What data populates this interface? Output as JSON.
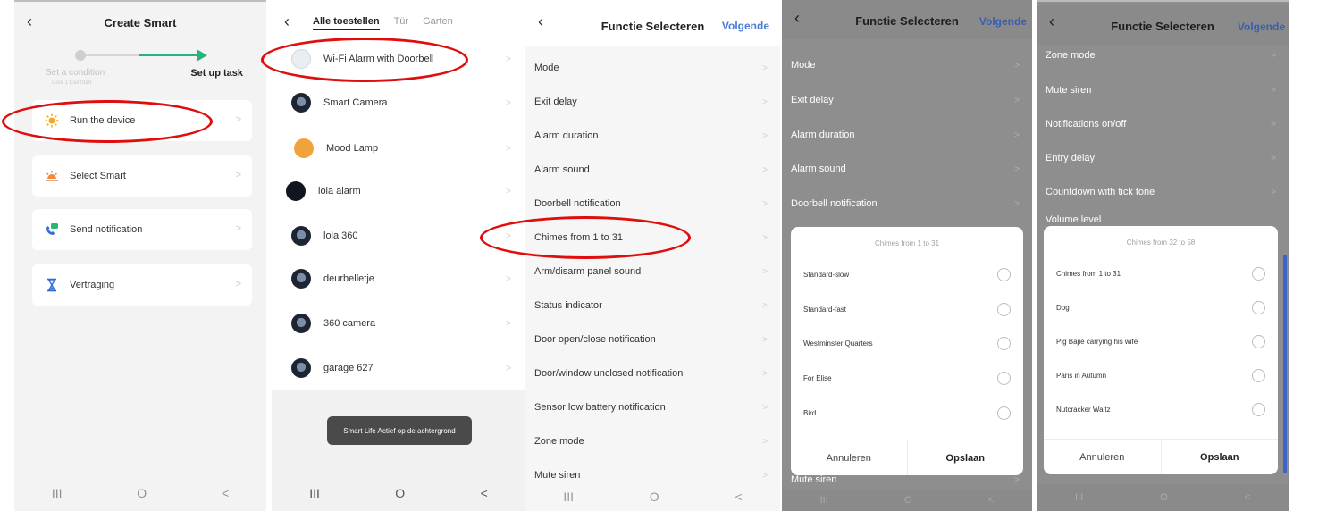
{
  "panel1": {
    "title": "Create Smart",
    "step_left": "Set a condition",
    "step_left_sub": "Door 1 Call Start",
    "step_right": "Set up task",
    "cards": [
      {
        "label": "Run the device",
        "icon": "sun-icon"
      },
      {
        "label": "Select Smart",
        "icon": "sunrise-icon"
      },
      {
        "label": "Send notification",
        "icon": "phone-message-icon"
      },
      {
        "label": "Vertraging",
        "icon": "hourglass-icon"
      }
    ],
    "nav": [
      "III",
      "O",
      "<"
    ]
  },
  "panel2": {
    "tabs": [
      "Alle toestellen",
      "Tür",
      "Garten"
    ],
    "devices": [
      {
        "label": "Wi-Fi Alarm with Doorbell",
        "icon": "doorbell-icon"
      },
      {
        "label": "Smart  Camera",
        "icon": "camera-icon"
      },
      {
        "label": "Mood Lamp",
        "icon": "lamp-icon"
      },
      {
        "label": "lola alarm",
        "icon": "alarm-icon"
      },
      {
        "label": "lola 360",
        "icon": "camera-icon"
      },
      {
        "label": "deurbelletje",
        "icon": "camera-icon"
      },
      {
        "label": "360 camera",
        "icon": "camera-icon"
      },
      {
        "label": "garage 627",
        "icon": "camera-icon"
      }
    ],
    "toast": "Smart Life Actief op de achtergrond",
    "nav": [
      "III",
      "O",
      "<"
    ]
  },
  "panel3": {
    "title": "Functie Selecteren",
    "next": "Volgende",
    "items": [
      "Mode",
      "Exit delay",
      "Alarm duration",
      "Alarm sound",
      "Doorbell notification",
      "Chimes from 1 to 31",
      "Arm/disarm panel sound",
      "Status indicator",
      "Door open/close notification",
      "Door/window unclosed notification",
      "Sensor low battery notification",
      "Zone mode",
      "Mute siren"
    ],
    "nav": [
      "III",
      "O",
      "<"
    ]
  },
  "panel4": {
    "title": "Functie Selecteren",
    "next": "Volgende",
    "items": [
      "Mode",
      "Exit delay",
      "Alarm duration",
      "Alarm sound",
      "Doorbell notification"
    ],
    "bottom_item": "Mute siren",
    "dialog": {
      "title": "Chimes from 1 to 31",
      "options": [
        "Standard-slow",
        "Standard-fast",
        "Westminster Quarters",
        "For Elise",
        "Bird"
      ],
      "cancel": "Annuleren",
      "save": "Opslaan"
    },
    "nav": [
      "III",
      "O",
      "<"
    ]
  },
  "panel5": {
    "title": "Functie Selecteren",
    "next": "Volgende",
    "items": [
      "Zone mode",
      "Mute siren",
      "Notifications on/off",
      "Entry delay",
      "Countdown with tick tone"
    ],
    "partial_item": "Volume level",
    "dialog": {
      "title": "Chimes from 32 to 58",
      "options": [
        "Chimes from 1 to 31",
        "Dog",
        "Pig Bajie carrying his wife",
        "Paris in Autumn",
        "Nutcracker Waltz"
      ],
      "cancel": "Annuleren",
      "save": "Opslaan"
    },
    "nav": [
      "III",
      "O",
      "<"
    ]
  },
  "colors": {
    "accent_blue": "#4a7dd6",
    "green": "#27b37b",
    "highlight_red": "#e00d0d",
    "overlay": "#8e8e8e"
  }
}
